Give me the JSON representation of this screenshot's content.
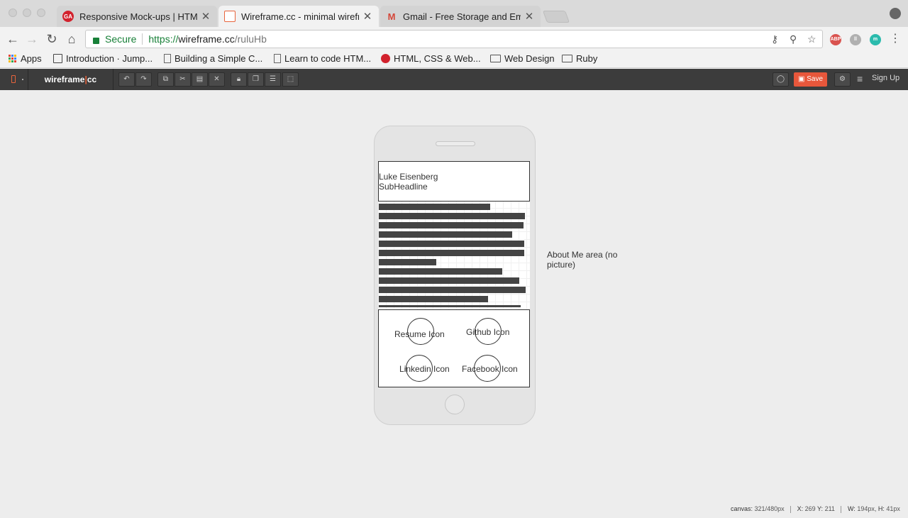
{
  "browser": {
    "tabs": [
      {
        "title": "Responsive Mock-ups | HTML, C",
        "favicon_text": "GA",
        "favicon_color": "#d2222d",
        "active": false
      },
      {
        "title": "Wireframe.cc - minimal wirefra",
        "favicon_text": "",
        "favicon_color": "#e8643c",
        "active": true
      },
      {
        "title": "Gmail - Free Storage and Emai",
        "favicon_text": "M",
        "favicon_color": "#d44638",
        "active": false
      }
    ],
    "address": {
      "secure_label": "Secure",
      "scheme": "https://",
      "host": "wireframe.cc",
      "path": "/ruluHb"
    },
    "extensions": [
      "ABP",
      "ll",
      "m"
    ],
    "bookmarks": [
      {
        "label": "Apps",
        "icon": "apps-grid-icon"
      },
      {
        "label": "Introduction · Jump...",
        "icon": "book-icon"
      },
      {
        "label": "Building a Simple C...",
        "icon": "page-icon"
      },
      {
        "label": "Learn to code HTM...",
        "icon": "page-icon"
      },
      {
        "label": "HTML, CSS & Web...",
        "icon": "ga-icon"
      },
      {
        "label": "Web Design",
        "icon": "folder-icon"
      },
      {
        "label": "Ruby",
        "icon": "folder-icon"
      }
    ]
  },
  "app": {
    "brand_left": "wireframe",
    "brand_sep": "|",
    "brand_right": "cc",
    "save_label": "Save",
    "signup_label": "Sign Up",
    "accent": "#e8573b"
  },
  "wireframe": {
    "header_title": "Luke Eisenberg",
    "header_subtitle": "SubHeadline",
    "icons": [
      {
        "label": "Resume Icon"
      },
      {
        "label": "Github Icon"
      },
      {
        "label": "Linkedin Icon"
      },
      {
        "label": "Facebook Icon"
      }
    ],
    "about_note": "About Me area (no picture)"
  },
  "status": {
    "canvas_label": "canvas:",
    "canvas_value": "321/480px",
    "x_label": "X:",
    "x_value": "269",
    "y_label": "Y:",
    "y_value": "211",
    "w_label": "W:",
    "w_value": "194px,",
    "h_label": "H:",
    "h_value": "41px"
  }
}
